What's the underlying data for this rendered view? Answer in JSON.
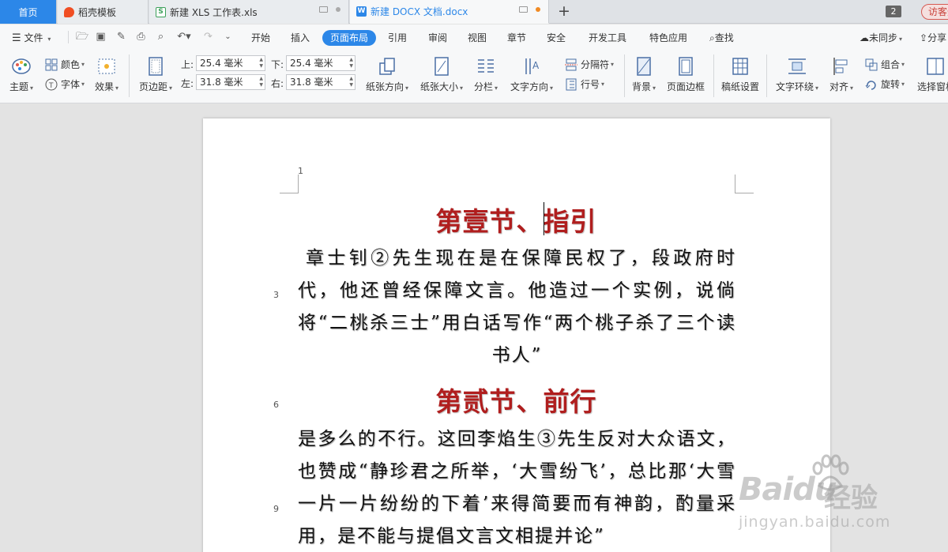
{
  "tabs": {
    "home": "首页",
    "t1": "稻壳模板",
    "t2": "新建 XLS 工作表.xls",
    "t3": "新建 DOCX 文档.docx",
    "window_count": "2",
    "visitor": "访客登录"
  },
  "menu": {
    "file": "文件",
    "start": "开始",
    "insert": "插入",
    "page_layout": "页面布局",
    "reference": "引用",
    "review": "审阅",
    "view": "视图",
    "chapter": "章节",
    "security": "安全",
    "dev_tools": "开发工具",
    "special_apps": "特色应用",
    "find": "查找",
    "unsynced": "未同步",
    "share": "分享"
  },
  "ribbon": {
    "theme": "主题",
    "color": "颜色",
    "font": "字体",
    "effect": "效果",
    "margins": "页边距",
    "top_label": "上:",
    "top_value": "25.4 毫米",
    "bottom_label": "下:",
    "bottom_value": "25.4 毫米",
    "left_label": "左:",
    "left_value": "31.8 毫米",
    "right_label": "右:",
    "right_value": "31.8 毫米",
    "orientation": "纸张方向",
    "paper_size": "纸张大小",
    "columns": "分栏",
    "text_direction": "文字方向",
    "breaks": "分隔符",
    "line_numbers": "行号",
    "background": "背景",
    "page_border": "页面边框",
    "manuscript": "稿纸设置",
    "text_wrap": "文字环绕",
    "align": "对齐",
    "group": "组合",
    "rotate": "旋转",
    "selection_pane": "选择窗格"
  },
  "document": {
    "page_number": "1",
    "line_numbers": [
      "3",
      "6",
      "9"
    ],
    "heading1": "第壹节、指引",
    "para1": "章士钊②先生现在是在保障民权了，段政府时代，他还曾经保障文言。他造过一个实例，说倘将“二桃杀三士”用白话写作“两个桃子杀了三个读书人”",
    "heading2": "第贰节、前行",
    "para2": "是多么的不行。这回李焰生③先生反对大众语文，也赞成“静珍君之所举，‘大雪纷飞’，总比那‘大雪一片一片纷纷的下着’来得简要而有神韵，酌量采用，是不能与提倡文言文相提并论”"
  },
  "watermark": {
    "brand": "Baidu",
    "cn": "经验",
    "url": "jingyan.baidu.com"
  }
}
